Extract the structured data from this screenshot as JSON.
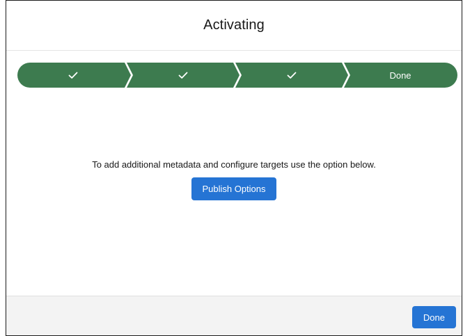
{
  "modal": {
    "title": "Activating"
  },
  "path": {
    "steps": [
      {
        "state": "complete",
        "icon": "check-icon",
        "label": ""
      },
      {
        "state": "complete",
        "icon": "check-icon",
        "label": ""
      },
      {
        "state": "complete",
        "icon": "check-icon",
        "label": ""
      },
      {
        "state": "current",
        "icon": "",
        "label": "Done"
      }
    ],
    "color": "#3d7b4f"
  },
  "content": {
    "message": "To add additional metadata and configure targets use the option below.",
    "publish_button_label": "Publish Options"
  },
  "footer": {
    "done_button_label": "Done"
  },
  "colors": {
    "brand_button": "#2574d4",
    "path_complete": "#3d7b4f"
  }
}
